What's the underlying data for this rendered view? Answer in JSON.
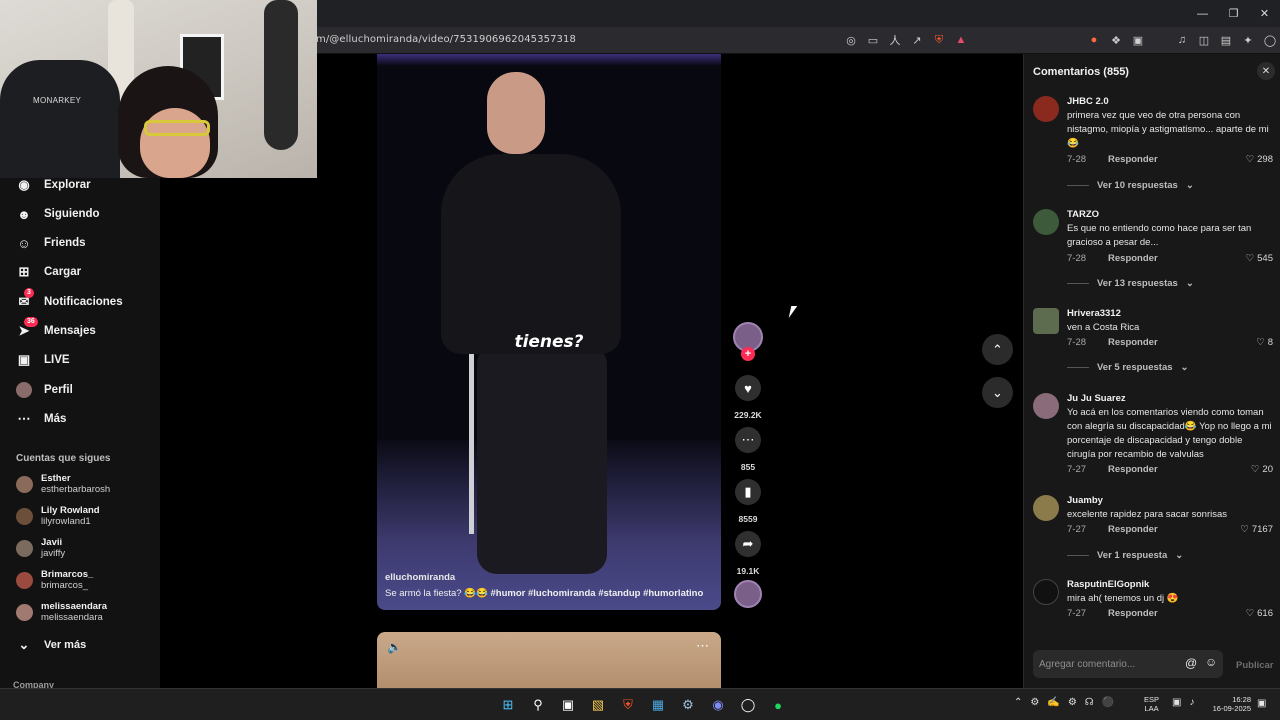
{
  "browser": {
    "url": "m/@elluchomiranda/video/7531906962045357318",
    "window_controls": [
      "minimize",
      "restore",
      "close"
    ]
  },
  "webcam": {
    "chair_brand": "MONARKEY"
  },
  "sidebar": {
    "nav": [
      {
        "label": "Explorar",
        "icon": "compass-icon"
      },
      {
        "label": "Siguiendo",
        "icon": "following-icon"
      },
      {
        "label": "Friends",
        "icon": "friends-icon"
      },
      {
        "label": "Cargar",
        "icon": "upload-icon"
      },
      {
        "label": "Notificaciones",
        "icon": "inbox-icon",
        "badge": "3"
      },
      {
        "label": "Mensajes",
        "icon": "send-icon",
        "badge": "36"
      },
      {
        "label": "LIVE",
        "icon": "live-icon"
      },
      {
        "label": "Perfil",
        "icon": "avatar-icon"
      },
      {
        "label": "Más",
        "icon": "more-icon"
      }
    ],
    "following_heading": "Cuentas que sigues",
    "accounts": [
      {
        "name": "Esther",
        "handle": "estherbarbarosh"
      },
      {
        "name": "Lily Rowland",
        "handle": "lilyrowland1"
      },
      {
        "name": "Javii",
        "handle": "javiffy"
      },
      {
        "name": "Brimarcos_",
        "handle": "brimarcos_"
      },
      {
        "name": "melissaendara",
        "handle": "melissaendara"
      }
    ],
    "see_more": "Ver más",
    "company": "Company"
  },
  "video": {
    "subtitle_word": "tienes?",
    "author": "elluchomiranda",
    "description": "Se armó la fiesta? 😂😂",
    "hashtags": [
      "#humor",
      "#luchomiranda",
      "#standup",
      "#humorlatino"
    ]
  },
  "actions": {
    "likes": "229.2K",
    "comments": "855",
    "saves": "8559",
    "shares": "19.1K"
  },
  "comments_panel": {
    "title": "Comentarios (855)",
    "reply_label": "Responder",
    "input_placeholder": "Agregar comentario...",
    "publish_label": "Publicar",
    "items": [
      {
        "user": "JHBC 2.0",
        "text": "primera vez que veo de otra persona con nistagmo, miopía y astigmatismo... aparte de mi 😂",
        "date": "7-28",
        "likes": "298",
        "replies": "Ver 10 respuestas",
        "avatar_color": "#8a2a1e"
      },
      {
        "user": "TARZO",
        "text": "Es que no entiendo como hace para ser tan gracioso a pesar de...",
        "date": "7-28",
        "likes": "545",
        "replies": "Ver 13 respuestas",
        "avatar_color": "#3d5a3a"
      },
      {
        "user": "Hrivera3312",
        "text": "ven a Costa Rica",
        "date": "7-28",
        "likes": "8",
        "replies": "Ver 5 respuestas",
        "avatar_color": "#5d6b4f"
      },
      {
        "user": "Ju Ju Suarez",
        "text": "Yo acá en los comentarios viendo como toman con alegría su discapacidad😂 Yop no llego a mi porcentaje de discapacidad y tengo doble cirugía por recambio de valvulas",
        "date": "7-27",
        "likes": "20",
        "replies": "",
        "avatar_color": "#8a6b7a"
      },
      {
        "user": "Juamby",
        "text": "excelente rapidez para sacar sonrisas",
        "date": "7-27",
        "likes": "7167",
        "replies": "Ver 1 respuesta",
        "avatar_color": "#8b7a4a"
      },
      {
        "user": "RasputinElGopnik",
        "text": "mira ah( tenemos un dj 😍",
        "date": "7-27",
        "likes": "616",
        "replies": "",
        "avatar_color": "#111111"
      }
    ]
  },
  "taskbar": {
    "lang_top": "ESP",
    "lang_bottom": "LAA",
    "time": "16:28",
    "date": "16-09-2025"
  },
  "colors": {
    "accent": "#fe2c55",
    "panel_bg": "#181818",
    "sidebar_bg": "#121212"
  }
}
